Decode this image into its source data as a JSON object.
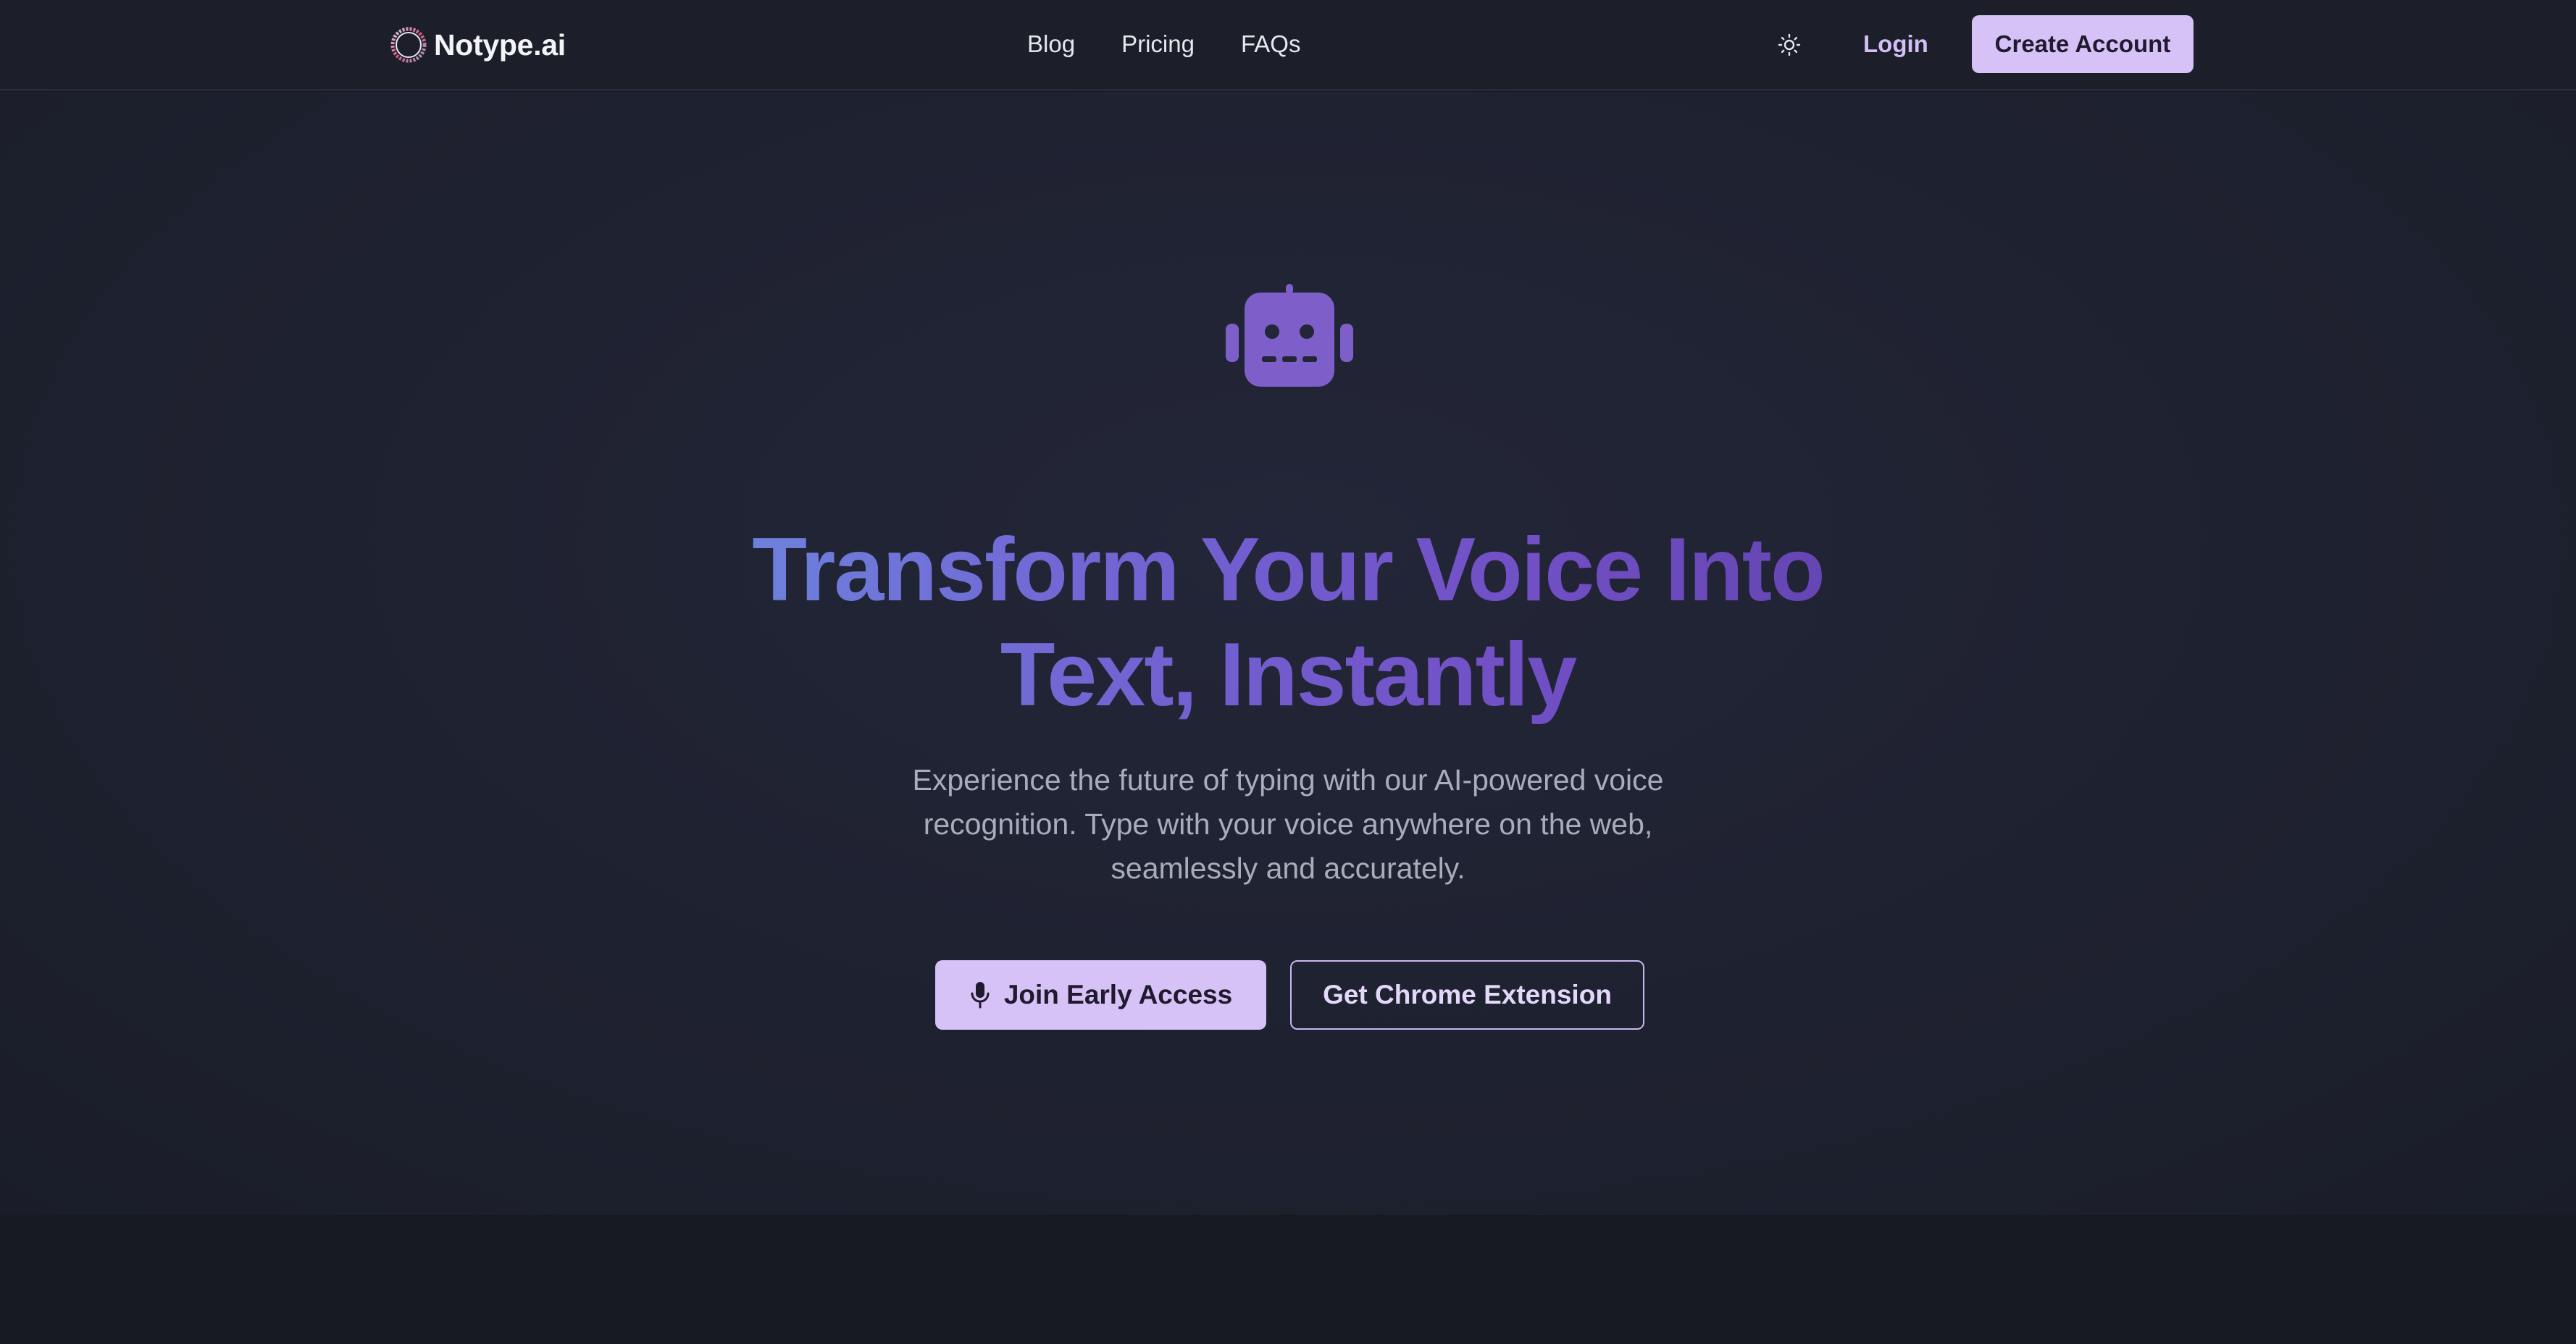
{
  "brand": {
    "name": "Notype.ai",
    "logo_icon": "ring-logo-icon"
  },
  "nav": {
    "links": [
      {
        "label": "Blog"
      },
      {
        "label": "Pricing"
      },
      {
        "label": "FAQs"
      }
    ],
    "theme_icon": "sun-icon",
    "login_label": "Login",
    "create_account_label": "Create Account"
  },
  "hero": {
    "icon": "robot-icon",
    "headline_line1": "Transform Your Voice Into",
    "headline_line2": "Text, Instantly",
    "subtitle": "Experience the future of typing with our AI-powered voice recognition. Type with your voice anywhere on the web, seamlessly and accurately.",
    "primary_cta": {
      "label": "Join Early Access",
      "icon": "microphone-icon"
    },
    "secondary_cta": {
      "label": "Get Chrome Extension"
    }
  },
  "colors": {
    "accent": "#d6c2f6",
    "robot": "#7e5fc9",
    "background": "#1f2231",
    "headline_gradient": [
      "#6a8fe0",
      "#7267d4",
      "#7250c6",
      "#5e3fa8"
    ]
  }
}
